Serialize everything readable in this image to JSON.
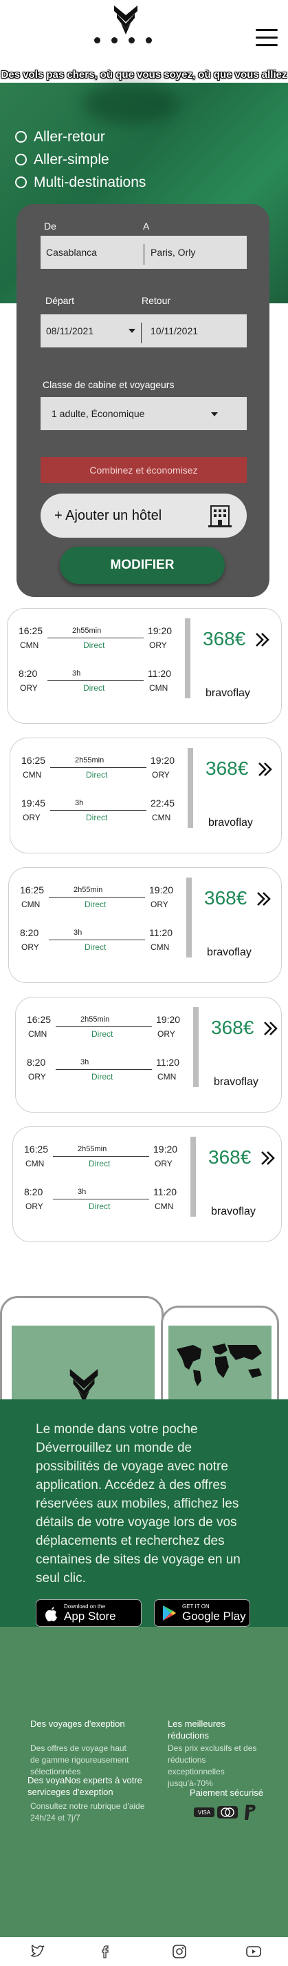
{
  "header": {
    "logo_icon": "bird-logo-icon",
    "menu_icon": "hamburger-menu-icon"
  },
  "tagline": "Des vols pas chers, où que vous soyez, où que vous alliez",
  "trip_types": [
    "Aller-retour",
    "Aller-simple",
    "Multi-destinations"
  ],
  "search": {
    "from_label": "De",
    "to_label": "A",
    "from_value": "Casablanca",
    "to_value": "Paris, Orly",
    "depart_label": "Départ",
    "return_label": "Retour",
    "depart_value": "08/11/2021",
    "return_value": "10/11/2021",
    "cabin_label": "Classe de cabine et voyageurs",
    "cabin_value": "1 adulte, Économique",
    "combine_label": "Combinez et économisez",
    "hotel_label": "+ Ajouter un hôtel",
    "hotel_icon": "hotel-building-icon",
    "modify_label": "MODIFIER"
  },
  "flights": [
    {
      "out": {
        "dep_time": "16:25",
        "dep_ap": "CMN",
        "duration": "2h55min",
        "type": "Direct",
        "arr_time": "19:20",
        "arr_ap": "ORY"
      },
      "ret": {
        "dep_time": "8:20",
        "dep_ap": "ORY",
        "duration": "3h",
        "type": "Direct",
        "arr_time": "11:20",
        "arr_ap": "CMN"
      },
      "price": "368€",
      "agency": "bravoflay"
    },
    {
      "out": {
        "dep_time": "16:25",
        "dep_ap": "CMN",
        "duration": "2h55min",
        "type": "Direct",
        "arr_time": "19:20",
        "arr_ap": "ORY"
      },
      "ret": {
        "dep_time": "19:45",
        "dep_ap": "ORY",
        "duration": "3h",
        "type": "Direct",
        "arr_time": "22:45",
        "arr_ap": "CMN"
      },
      "price": "368€",
      "agency": "bravoflay"
    },
    {
      "out": {
        "dep_time": "16:25",
        "dep_ap": "CMN",
        "duration": "2h55min",
        "type": "Direct",
        "arr_time": "19:20",
        "arr_ap": "ORY"
      },
      "ret": {
        "dep_time": "8:20",
        "dep_ap": "ORY",
        "duration": "3h",
        "type": "Direct",
        "arr_time": "11:20",
        "arr_ap": "CMN"
      },
      "price": "368€",
      "agency": "bravoflay"
    },
    {
      "out": {
        "dep_time": "16:25",
        "dep_ap": "CMN",
        "duration": "2h55min",
        "type": "Direct",
        "arr_time": "19:20",
        "arr_ap": "ORY"
      },
      "ret": {
        "dep_time": "8:20",
        "dep_ap": "ORY",
        "duration": "3h",
        "type": "Direct",
        "arr_time": "11:20",
        "arr_ap": "CMN"
      },
      "price": "368€",
      "agency": "bravoflay"
    },
    {
      "out": {
        "dep_time": "16:25",
        "dep_ap": "CMN",
        "duration": "2h55min",
        "type": "Direct",
        "arr_time": "19:20",
        "arr_ap": "ORY"
      },
      "ret": {
        "dep_time": "8:20",
        "dep_ap": "ORY",
        "duration": "3h",
        "type": "Direct",
        "arr_time": "11:20",
        "arr_ap": "CMN"
      },
      "price": "368€",
      "agency": "bravoflay"
    }
  ],
  "promo": {
    "text": "Le monde dans votre poche Déverrouillez un monde de possibilités de voyage avec notre application. Accédez à des offres réservées aux mobiles, affichez les détails de votre voyage lors de vos déplacements et recherchez des centaines de sites de voyage en un seul clic.",
    "appstore_small": "Download on the",
    "appstore_big": "App Store",
    "googleplay_small": "GET IT ON",
    "googleplay_big": "Google Play"
  },
  "footer": {
    "col1_title": "Des voyages d'exeption",
    "col1_desc": "Des offres de voyage haut de gamme rigoureusement sélectionnées",
    "col2_title": "Les meilleures réductions",
    "col2_desc": "Des prix exclusifs et des réductions exceptionnelles jusqu'à-70%",
    "col3_title": "Des voyaNos experts à votre serviceges d'exeption",
    "col3_desc": "Consultez notre rubrique d'aide 24h/24 et 7j/7",
    "payment_title": "Paiement sécurisé",
    "payment_visa": "VISA"
  },
  "social": [
    "twitter-icon",
    "facebook-icon",
    "instagram-icon",
    "youtube-icon"
  ],
  "colors": {
    "brand_green": "#1f6b43",
    "price_green": "#1f8a57",
    "combine_red": "#a63a3a"
  }
}
